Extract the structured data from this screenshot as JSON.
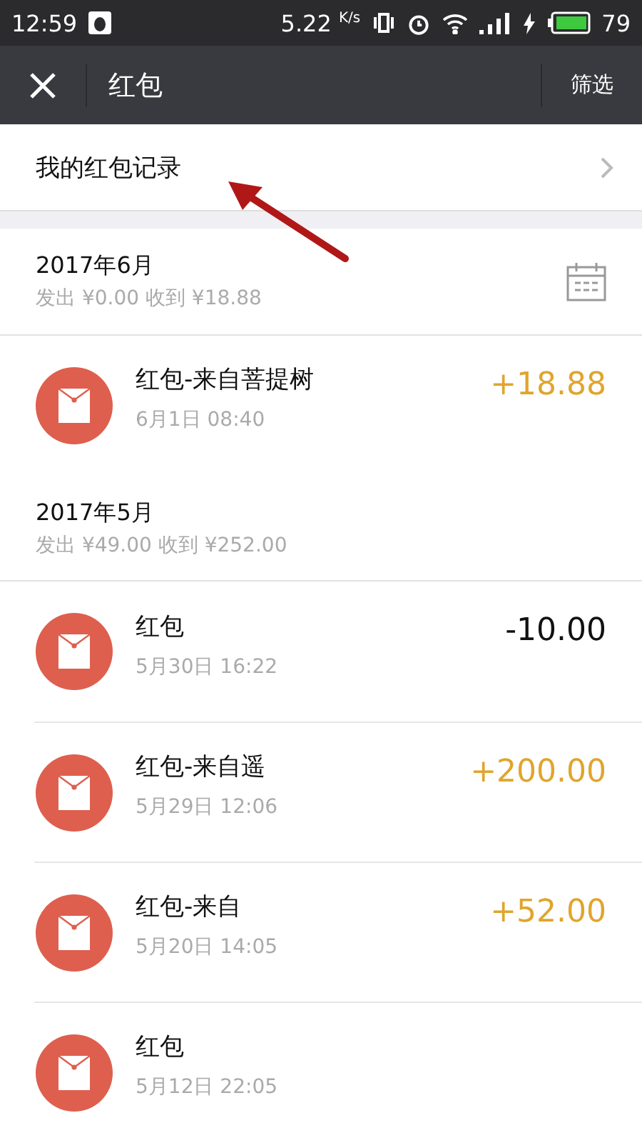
{
  "status_bar": {
    "time": "12:59",
    "speed": "5.22",
    "speed_unit": "K/s",
    "battery": "79"
  },
  "nav": {
    "title": "红包",
    "action": "筛选"
  },
  "record_link": {
    "label": "我的红包记录"
  },
  "months": [
    {
      "title": "2017年6月",
      "summary": "发出 ¥0.00 收到 ¥18.88",
      "calendar": true,
      "entries": [
        {
          "title": "红包-来自菩提树",
          "time": "6月1日 08:40",
          "amount": "+18.88",
          "kind": "income"
        }
      ]
    },
    {
      "title": "2017年5月",
      "summary": "发出 ¥49.00 收到 ¥252.00",
      "calendar": false,
      "entries": [
        {
          "title": "红包",
          "time": "5月30日 16:22",
          "amount": "-10.00",
          "kind": "expense"
        },
        {
          "title": "红包-来自遥",
          "time": "5月29日 12:06",
          "amount": "+200.00",
          "kind": "income"
        },
        {
          "title": "红包-来自",
          "time": "5月20日 14:05",
          "amount": "+52.00",
          "kind": "income"
        },
        {
          "title": "红包",
          "time": "5月12日 22:05"
        }
      ]
    }
  ]
}
